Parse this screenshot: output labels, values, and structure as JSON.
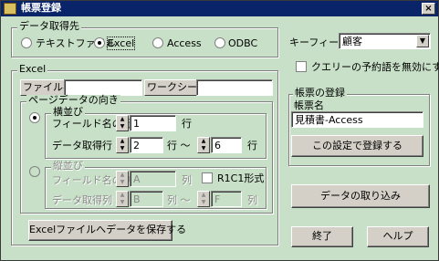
{
  "window": {
    "title": "帳票登録",
    "close": "×"
  },
  "source": {
    "legend": "データ取得先",
    "options": [
      "テキストファイル",
      "Excel",
      "Access",
      "ODBC"
    ]
  },
  "excel": {
    "legend": "Excel",
    "file_label": "ファイル名",
    "file_value": "",
    "sheet_label": "ワークシート名",
    "sheet_value": ""
  },
  "orientation": {
    "legend": "ページデータの向き",
    "horizontal": {
      "legend": "横並び",
      "field_row_label": "フィールド名の行",
      "field_row_value": "1",
      "field_row_unit": "行",
      "data_row_label": "データ取得行",
      "data_row_from": "2",
      "range_sep": "行 〜",
      "data_row_to": "6",
      "data_row_unit": "行"
    },
    "vertical": {
      "legend": "縦並び",
      "field_col_label": "フィールド名の列",
      "field_col_value": "A",
      "field_col_unit": "列",
      "r1c1_label": "R1C1形式",
      "data_col_label": "データ取得列",
      "data_col_from": "B",
      "range_sep": "列 〜",
      "data_col_to": "F",
      "data_col_unit": "列"
    }
  },
  "save_excel_button": "Excelファイルへデータを保存する",
  "key_field": {
    "label": "キーフィールド",
    "value": "顧客"
  },
  "disable_reserved": "クエリーの予約語を無効にする",
  "register": {
    "legend": "帳票の登録",
    "name_label": "帳票名",
    "name_value": "見積書-Access",
    "register_button": "この設定で登録する"
  },
  "import_button": "データの取り込み",
  "exit_button": "終了",
  "help_button": "ヘルプ",
  "icons": {
    "spin_up": "▲",
    "spin_down": "▼",
    "dropdown": "▼"
  }
}
